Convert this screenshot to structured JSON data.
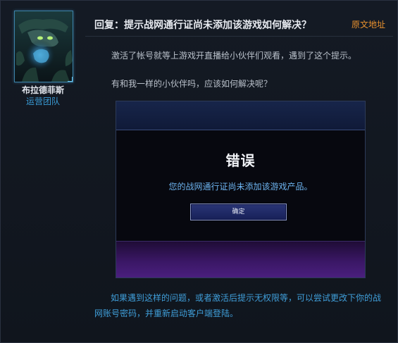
{
  "author": {
    "name": "布拉德菲斯",
    "role": "运营团队"
  },
  "post": {
    "title": "回复：提示战网通行证尚未添加该游戏如何解决？",
    "source_link": "原文地址",
    "paragraph_1": "激活了帐号就等上游戏开直播给小伙伴们观看，遇到了这个提示。",
    "paragraph_2": "有和我一样的小伙伴吗，应该如何解决呢？",
    "solution_line_1": "如果遇到这样的问题，或者激活后提示无权限等，可以尝试更改下你的战",
    "solution_line_2": "网账号密码，并重新启动客户端登陆。"
  },
  "dialog": {
    "title": "错误",
    "message": "您的战网通行证尚未添加该游戏产品。",
    "ok_label": "确定"
  },
  "colors": {
    "accent_orange": "#e8912e",
    "link_blue": "#3f9ed9",
    "background": "#12161e"
  }
}
